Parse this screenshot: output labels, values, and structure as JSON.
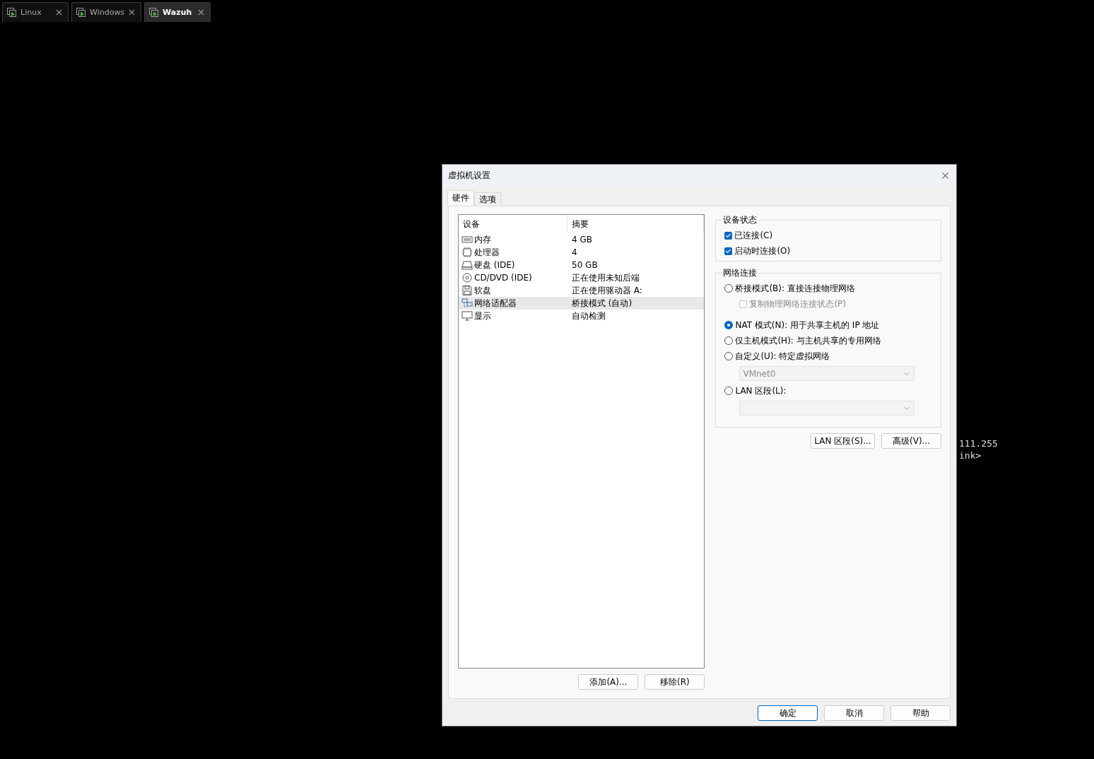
{
  "vm_tabs": [
    {
      "label": "Linux",
      "selected": false
    },
    {
      "label": "Windows",
      "selected": false
    },
    {
      "label": "Wazuh",
      "selected": true
    }
  ],
  "terminal_lines": [
    "111.255",
    "ink>"
  ],
  "dialog": {
    "title": "虚拟机设置",
    "tabs": [
      {
        "label": "硬件",
        "selected": true
      },
      {
        "label": "选项",
        "selected": false
      }
    ],
    "device_table": {
      "columns": [
        "设备",
        "摘要"
      ],
      "rows": [
        {
          "kind": "memory",
          "device": "内存",
          "summary": "4 GB",
          "selected": false
        },
        {
          "kind": "cpu",
          "device": "处理器",
          "summary": "4",
          "selected": false
        },
        {
          "kind": "disk",
          "device": "硬盘 (IDE)",
          "summary": "50 GB",
          "selected": false
        },
        {
          "kind": "cd",
          "device": "CD/DVD (IDE)",
          "summary": "正在使用未知后端",
          "selected": false
        },
        {
          "kind": "floppy",
          "device": "软盘",
          "summary": "正在使用驱动器 A:",
          "selected": false
        },
        {
          "kind": "network",
          "device": "网络适配器",
          "summary": "桥接模式 (自动)",
          "selected": true
        },
        {
          "kind": "display",
          "device": "显示",
          "summary": "自动检测",
          "selected": false
        }
      ]
    },
    "list_buttons": [
      "添加(A)...",
      "移除(R)"
    ],
    "device_status": {
      "title": "设备状态",
      "options": [
        {
          "label": "已连接(C)",
          "checked": true
        },
        {
          "label": "启动时连接(O)",
          "checked": true
        }
      ]
    },
    "network_connection": {
      "title": "网络连接",
      "options": [
        {
          "kind": "radio",
          "label": "桥接模式(B): 直接连接物理网络",
          "selected": false
        },
        {
          "kind": "checkbox",
          "label": "复制物理网络连接状态(P)",
          "checked": false,
          "disabled": true
        },
        {
          "kind": "radio",
          "label": "NAT 模式(N): 用于共享主机的 IP 地址",
          "selected": true
        },
        {
          "kind": "radio",
          "label": "仅主机模式(H): 与主机共享的专用网络",
          "selected": false
        },
        {
          "kind": "radio",
          "label": "自定义(U): 特定虚拟网络",
          "selected": false
        },
        {
          "kind": "select",
          "value": "VMnet0",
          "disabled": true
        },
        {
          "kind": "radio",
          "label": "LAN 区段(L):",
          "selected": false
        },
        {
          "kind": "select",
          "disabled": true
        }
      ]
    },
    "network_buttons": [
      "LAN 区段(S)...",
      "高级(V)..."
    ],
    "footer_buttons": [
      {
        "label": "确定",
        "default": true
      },
      {
        "label": "取消",
        "default": false
      },
      {
        "label": "帮助",
        "default": false
      }
    ]
  }
}
